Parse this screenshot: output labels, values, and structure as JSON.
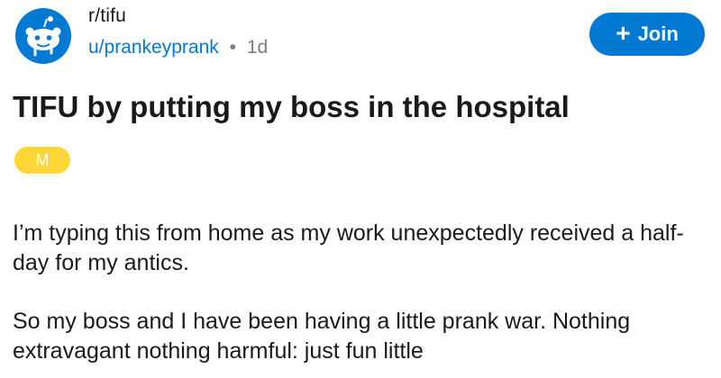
{
  "post": {
    "subreddit": "r/tifu",
    "author": "u/prankeyprank",
    "separator": "•",
    "age": "1d",
    "join_label": "Join",
    "title": "TIFU by putting my boss in the hospital",
    "flair": "M",
    "paragraphs": [
      "I’m typing this from home as my work unexpectedly received a half-day for my antics.",
      "So my boss and I have been having a little prank war. Nothing extravagant nothing harmful: just fun little"
    ]
  },
  "colors": {
    "accent": "#0079d3",
    "flair": "#ffd635",
    "muted": "#7c7c7c"
  },
  "icons": {
    "subreddit": "reddit-snoo-icon",
    "join": "plus-icon"
  }
}
